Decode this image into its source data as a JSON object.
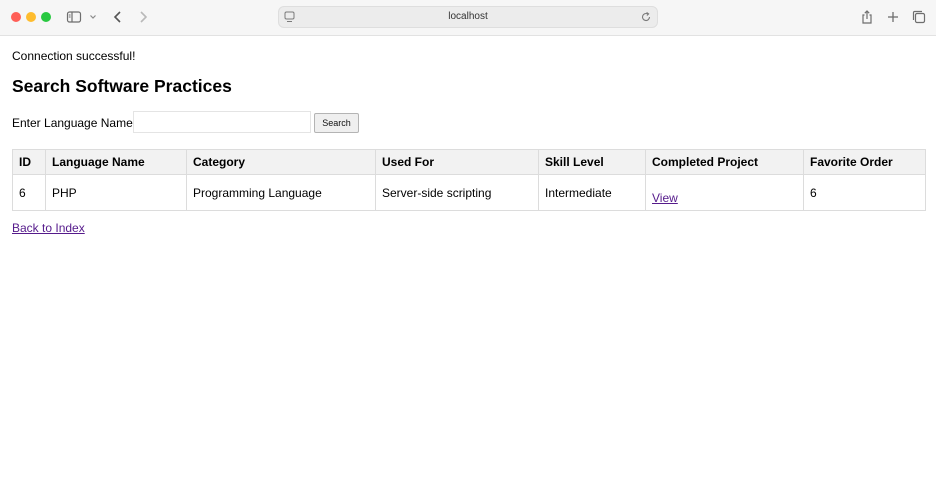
{
  "browser": {
    "address": "localhost",
    "colors": {
      "close": "#ff5f57",
      "minimize": "#febc2e",
      "maximize": "#28c840"
    },
    "icons": [
      "sidebar-icon",
      "chevron-down-icon",
      "back-arrow-icon",
      "forward-arrow-icon",
      "page-icon",
      "reload-icon",
      "share-icon",
      "new-tab-icon",
      "tab-overview-icon"
    ]
  },
  "page": {
    "status_message": "Connection successful!",
    "title": "Search Software Practices",
    "search": {
      "label": "Enter Language Name:",
      "value": "",
      "placeholder": "",
      "button": "Search"
    },
    "table": {
      "headers": [
        "ID",
        "Language Name",
        "Category",
        "Used For",
        "Skill Level",
        "Completed Project",
        "Favorite Order"
      ],
      "rows": [
        [
          "6",
          "PHP",
          "Programming Language",
          "Server-side scripting",
          "Intermediate",
          "View",
          "6"
        ]
      ]
    },
    "back_link": "Back to Index",
    "link_color": "#551a8b"
  }
}
